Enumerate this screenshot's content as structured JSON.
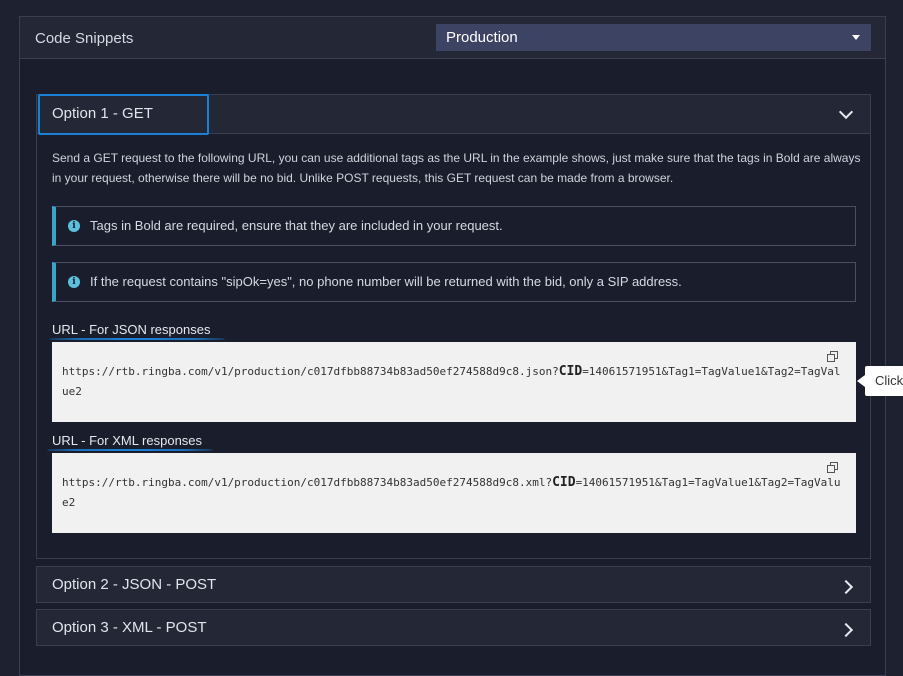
{
  "panel": {
    "title": "Code Snippets",
    "environment_selected": "Production"
  },
  "option1": {
    "title": "Option 1 - GET",
    "description": "Send a GET request to the following URL, you can use additional tags as the URL in the example shows, just make sure that the tags in Bold are always in your request, otherwise there will be no bid. Unlike POST requests, this GET request can be made from a browser.",
    "alerts": [
      "Tags in Bold are required, ensure that they are included in your request.",
      "If the request contains \"sipOk=yes\", no phone number will be returned with the bid, only a SIP address."
    ],
    "json_label": "URL - For JSON responses",
    "json_url_prefix": "https://rtb.ringba.com/v1/production/c017dfbb88734b83ad50ef274588d9c8.json?",
    "json_url_bold": "CID",
    "json_url_suffix": "=14061571951&Tag1=TagValue1&Tag2=TagValue2",
    "xml_label": "URL - For XML responses",
    "xml_url_prefix": "https://rtb.ringba.com/v1/production/c017dfbb88734b83ad50ef274588d9c8.xml?",
    "xml_url_bold": "CID",
    "xml_url_suffix": "=14061571951&Tag1=TagValue1&Tag2=TagValue2"
  },
  "option2": {
    "title": "Option 2 - JSON - POST"
  },
  "option3": {
    "title": "Option 3 - XML - POST"
  },
  "tooltip": {
    "text": "Click"
  },
  "colors": {
    "accent": "#1a7fd6",
    "info": "#5bc0de",
    "select_bg": "#3d4463"
  },
  "icons": [
    "chevron-down-icon",
    "chevron-right-icon",
    "info-icon",
    "copy-icon",
    "caret-down-icon"
  ]
}
